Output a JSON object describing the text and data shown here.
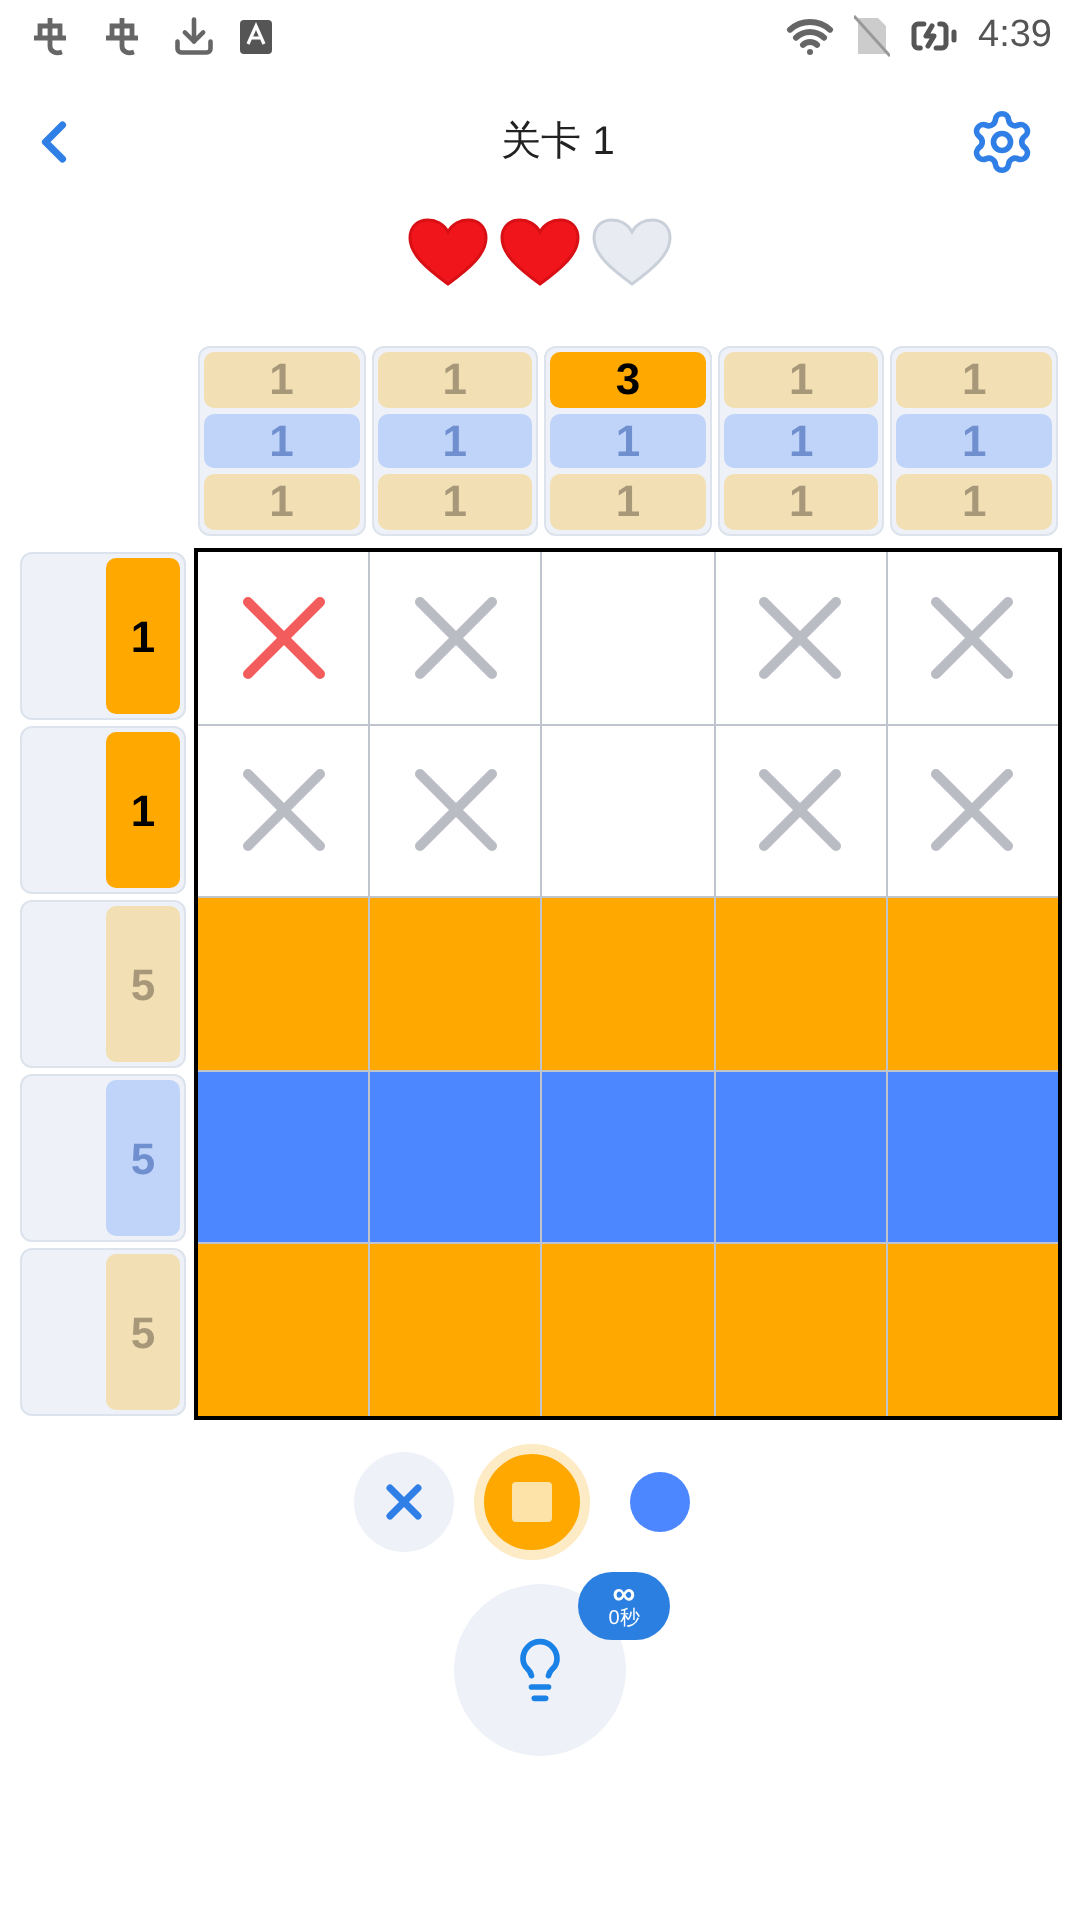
{
  "status_bar": {
    "time": "4:39"
  },
  "header": {
    "title": "关卡 1"
  },
  "lives": [
    {
      "filled": true
    },
    {
      "filled": true
    },
    {
      "filled": false
    }
  ],
  "column_clues": [
    {
      "clues": [
        {
          "text": "1",
          "kind": "orange",
          "active": false
        },
        {
          "text": "1",
          "kind": "blue",
          "active": false
        },
        {
          "text": "1",
          "kind": "orange",
          "active": false
        }
      ]
    },
    {
      "clues": [
        {
          "text": "1",
          "kind": "orange",
          "active": false
        },
        {
          "text": "1",
          "kind": "blue",
          "active": false
        },
        {
          "text": "1",
          "kind": "orange",
          "active": false
        }
      ]
    },
    {
      "clues": [
        {
          "text": "3",
          "kind": "orange",
          "active": true
        },
        {
          "text": "1",
          "kind": "blue",
          "active": false
        },
        {
          "text": "1",
          "kind": "orange",
          "active": false
        }
      ]
    },
    {
      "clues": [
        {
          "text": "1",
          "kind": "orange",
          "active": false
        },
        {
          "text": "1",
          "kind": "blue",
          "active": false
        },
        {
          "text": "1",
          "kind": "orange",
          "active": false
        }
      ]
    },
    {
      "clues": [
        {
          "text": "1",
          "kind": "orange",
          "active": false
        },
        {
          "text": "1",
          "kind": "blue",
          "active": false
        },
        {
          "text": "1",
          "kind": "orange",
          "active": false
        }
      ]
    }
  ],
  "rows": [
    {
      "clues": [
        {
          "text": "1",
          "kind": "orange",
          "active": true
        }
      ],
      "cells": [
        {
          "kind": "wrong-cross"
        },
        {
          "kind": "cross"
        },
        {
          "kind": "blank"
        },
        {
          "kind": "cross"
        },
        {
          "kind": "cross"
        }
      ]
    },
    {
      "clues": [
        {
          "text": "1",
          "kind": "orange",
          "active": true
        }
      ],
      "cells": [
        {
          "kind": "cross"
        },
        {
          "kind": "cross"
        },
        {
          "kind": "blank"
        },
        {
          "kind": "cross"
        },
        {
          "kind": "cross"
        }
      ]
    },
    {
      "clues": [
        {
          "text": "5",
          "kind": "orange",
          "active": false
        }
      ],
      "cells": [
        {
          "kind": "orange"
        },
        {
          "kind": "orange"
        },
        {
          "kind": "orange"
        },
        {
          "kind": "orange"
        },
        {
          "kind": "orange"
        }
      ]
    },
    {
      "clues": [
        {
          "text": "5",
          "kind": "blue",
          "active": false
        }
      ],
      "cells": [
        {
          "kind": "blue"
        },
        {
          "kind": "blue"
        },
        {
          "kind": "blue"
        },
        {
          "kind": "blue"
        },
        {
          "kind": "blue"
        }
      ]
    },
    {
      "clues": [
        {
          "text": "5",
          "kind": "orange",
          "active": false
        }
      ],
      "cells": [
        {
          "kind": "orange"
        },
        {
          "kind": "orange"
        },
        {
          "kind": "orange"
        },
        {
          "kind": "orange"
        },
        {
          "kind": "orange"
        }
      ]
    }
  ],
  "tools": [
    {
      "kind": "cross",
      "selected": false
    },
    {
      "kind": "orange",
      "selected": true
    },
    {
      "kind": "blue",
      "selected": false
    }
  ],
  "hint": {
    "badge_symbol": "∞",
    "badge_time": "0秒"
  }
}
